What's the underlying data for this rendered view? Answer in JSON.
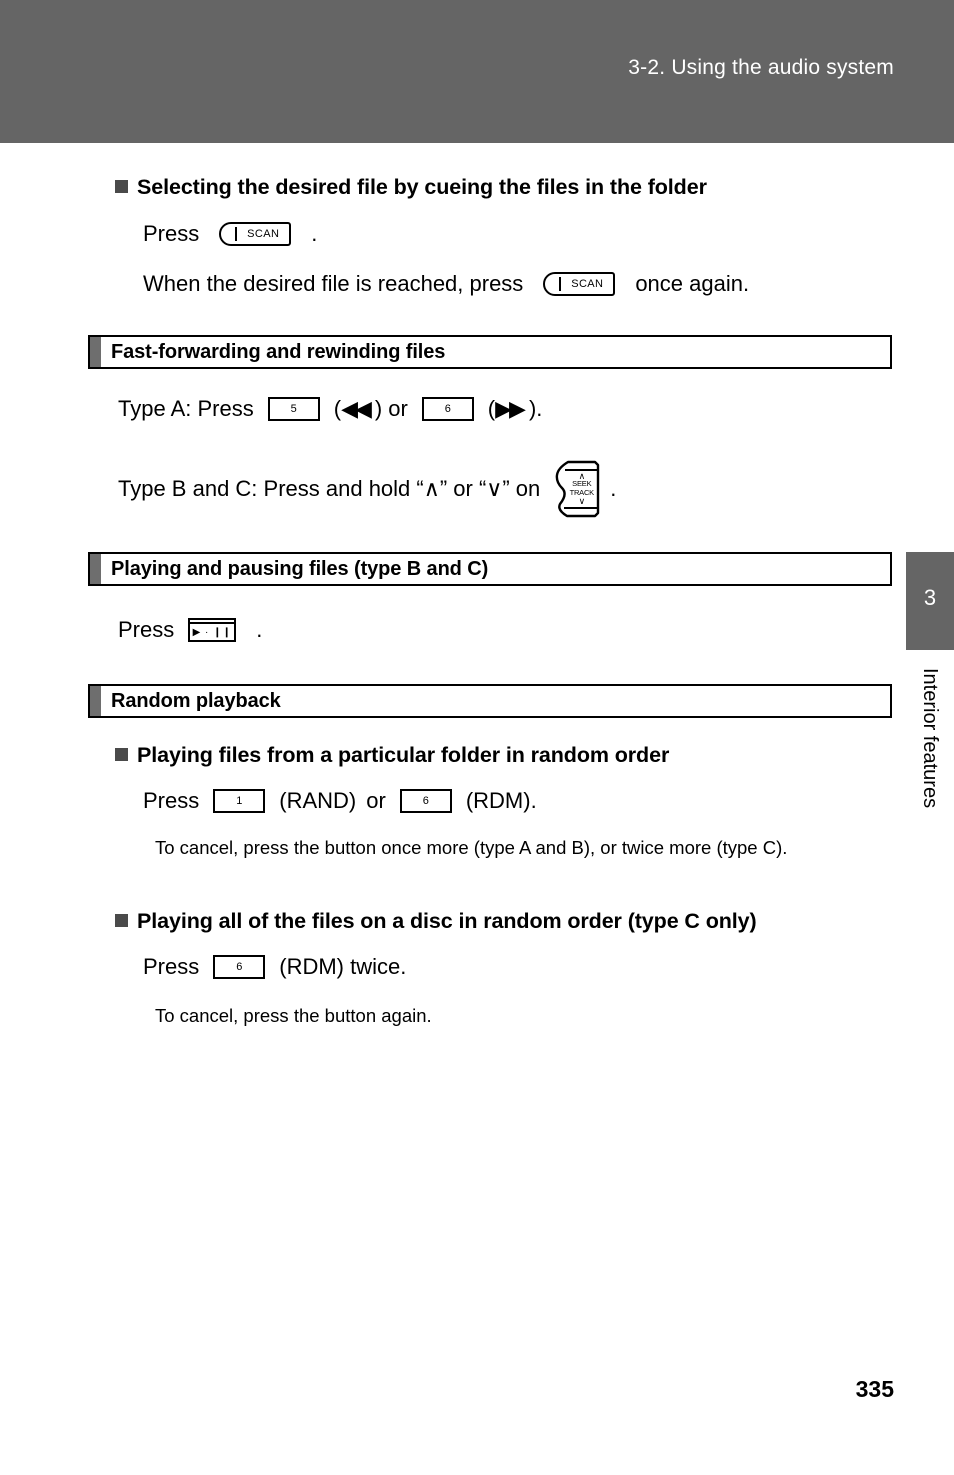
{
  "header": {
    "title": "3-2. Using the audio system"
  },
  "side_tab": {
    "number": "3",
    "label": "Interior features"
  },
  "page": {
    "number": "335"
  },
  "colors": {
    "band_gray": "#656565",
    "accent_gray": "#6e6e6e",
    "bullet_gray": "#4a4a4a"
  },
  "sections": {
    "cueing": {
      "heading": "Selecting the desired file by cueing the files in the folder",
      "press_label": "Press",
      "press_period": ".",
      "scan_button": "SCAN",
      "second_line_prefix": "When the desired file is reached, press",
      "second_line_suffix": "once again."
    },
    "fast_forward": {
      "title": "Fast-forwarding and rewinding files",
      "type_a_prefix": "Type A: Press",
      "type_a_btn1": "5",
      "type_a_paren1_open": "(",
      "type_a_arrow_rewind": "◀◀",
      "type_a_paren1_close": ")",
      "type_a_or": "or",
      "type_a_btn2": "6",
      "type_a_paren2_open": "(",
      "type_a_arrow_forward": "▶▶",
      "type_a_paren2_close": ").",
      "type_bc_prefix": "Type B and C: Press and hold “∧” or “∨” on",
      "type_bc_period": ".",
      "seek_caret_up": "∧",
      "seek_line1": "SEEK",
      "seek_line2": "TRACK",
      "seek_caret_down": "∨"
    },
    "play_pause": {
      "title": "Playing and pausing files (type B and C)",
      "press_label": "Press",
      "press_period": ".",
      "button_glyph": "▶ · ❙❙"
    },
    "random": {
      "title": "Random playback",
      "sub1": {
        "heading": "Playing files from a particular folder in random order",
        "press_label": "Press",
        "btn1": "1",
        "btn1_caption": "(RAND)",
        "or": "or",
        "btn2": "6",
        "btn2_caption": "(RDM).",
        "note": "To cancel, press the button once more (type A and B), or twice more (type C)."
      },
      "sub2": {
        "heading": "Playing all of the files on a disc in random order (type C only)",
        "press_label": "Press",
        "btn1": "6",
        "btn1_caption": "(RDM) twice.",
        "note": "To cancel, press the button again."
      }
    }
  }
}
